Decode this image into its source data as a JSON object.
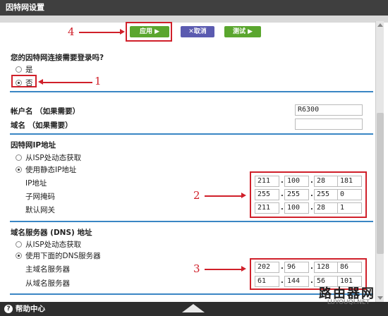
{
  "window": {
    "title": "因特网设置"
  },
  "toolbar": {
    "apply_label": "应用 ▶",
    "cancel_label": "✕取消",
    "test_label": "测试 ▶"
  },
  "annotations": {
    "n1": "1",
    "n2": "2",
    "n3": "3",
    "n4": "4"
  },
  "login": {
    "question": "您的因特网连接需要登录吗?",
    "options": [
      {
        "label": "是",
        "checked": false
      },
      {
        "label": "否",
        "checked": true
      }
    ]
  },
  "account": {
    "account_label": "帐户名 （如果需要）",
    "account_value": "R6300",
    "domain_label": "域名 （如果需要）",
    "domain_value": ""
  },
  "ip_section": {
    "title": "因特网IP地址",
    "options": [
      {
        "label": "从ISP处动态获取",
        "checked": false
      },
      {
        "label": "使用静态IP地址",
        "checked": true
      }
    ],
    "fields": [
      {
        "label": "IP地址",
        "octets": [
          "211",
          "100",
          "28",
          "181"
        ]
      },
      {
        "label": "子网掩码",
        "octets": [
          "255",
          "255",
          "255",
          "0"
        ]
      },
      {
        "label": "默认网关",
        "octets": [
          "211",
          "100",
          "28",
          "1"
        ]
      }
    ]
  },
  "dns_section": {
    "title": "域名服务器 (DNS) 地址",
    "options": [
      {
        "label": "从ISP处动态获取",
        "checked": false
      },
      {
        "label": "使用下面的DNS服务器",
        "checked": true
      }
    ],
    "fields": [
      {
        "label": "主域名服务器",
        "octets": [
          "202",
          "96",
          "128",
          "86"
        ]
      },
      {
        "label": "从域名服务器",
        "octets": [
          "61",
          "144",
          "56",
          "101"
        ]
      }
    ]
  },
  "footer": {
    "help_label": "帮助中心",
    "help_icon": "question-icon"
  },
  "watermark": {
    "main": "路由器网",
    "sub": "LUYOUQI.NET"
  },
  "colors": {
    "accent_red": "#d0202a",
    "apply_green": "#5aa62e",
    "cancel_blue": "#5b5bb0",
    "divider_blue": "#3a86c4"
  }
}
